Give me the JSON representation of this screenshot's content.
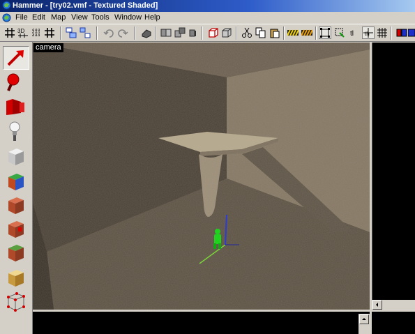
{
  "window": {
    "title": "Hammer - [try02.vmf - Textured Shaded]"
  },
  "menu": {
    "items": [
      "File",
      "Edit",
      "Map",
      "View",
      "Tools",
      "Window",
      "Help"
    ]
  },
  "toolbar": {
    "icons": [
      "grid-toggle-icon",
      "grid-3d-icon",
      "dot-grid-icon",
      "grid-plus-icon",
      "group-icon",
      "ungroup-icon",
      "undo-icon",
      "redo-icon",
      "carve-icon",
      "entity-icon",
      "hide-icon",
      "solid-icon",
      "cube-outline-icon",
      "cube-filled-icon",
      "cut-icon",
      "copy-icon",
      "paste-icon",
      "texture-lock-icon",
      "texture-lock-alt-icon",
      "select-bounds-icon",
      "select-handles-icon",
      "text-tl-icon",
      "text-xyz-icon",
      "grid-dense-icon",
      "texture-browser-icon"
    ],
    "pressed": [
      "select-bounds-icon",
      "text-xyz-icon"
    ]
  },
  "tools": [
    {
      "name": "selection-tool",
      "selected": true
    },
    {
      "name": "magnify-tool",
      "selected": false
    },
    {
      "name": "camera-tool",
      "selected": false
    },
    {
      "name": "entity-tool",
      "selected": false
    },
    {
      "name": "block-tool",
      "selected": false
    },
    {
      "name": "texture-application-tool",
      "selected": false
    },
    {
      "name": "apply-texture-tool",
      "selected": false
    },
    {
      "name": "decal-tool",
      "selected": false
    },
    {
      "name": "overlay-tool",
      "selected": false
    },
    {
      "name": "clipping-tool",
      "selected": false
    },
    {
      "name": "vertex-tool",
      "selected": false
    }
  ],
  "viewport": {
    "label": "camera"
  },
  "colors": {
    "titlebar_start": "#0a246a",
    "titlebar_end": "#a6caf0",
    "chrome": "#d4d0c8",
    "entity_green": "#1fd31f",
    "axis_blue": "#2d3bd1",
    "axis_green": "#7ad23a"
  }
}
